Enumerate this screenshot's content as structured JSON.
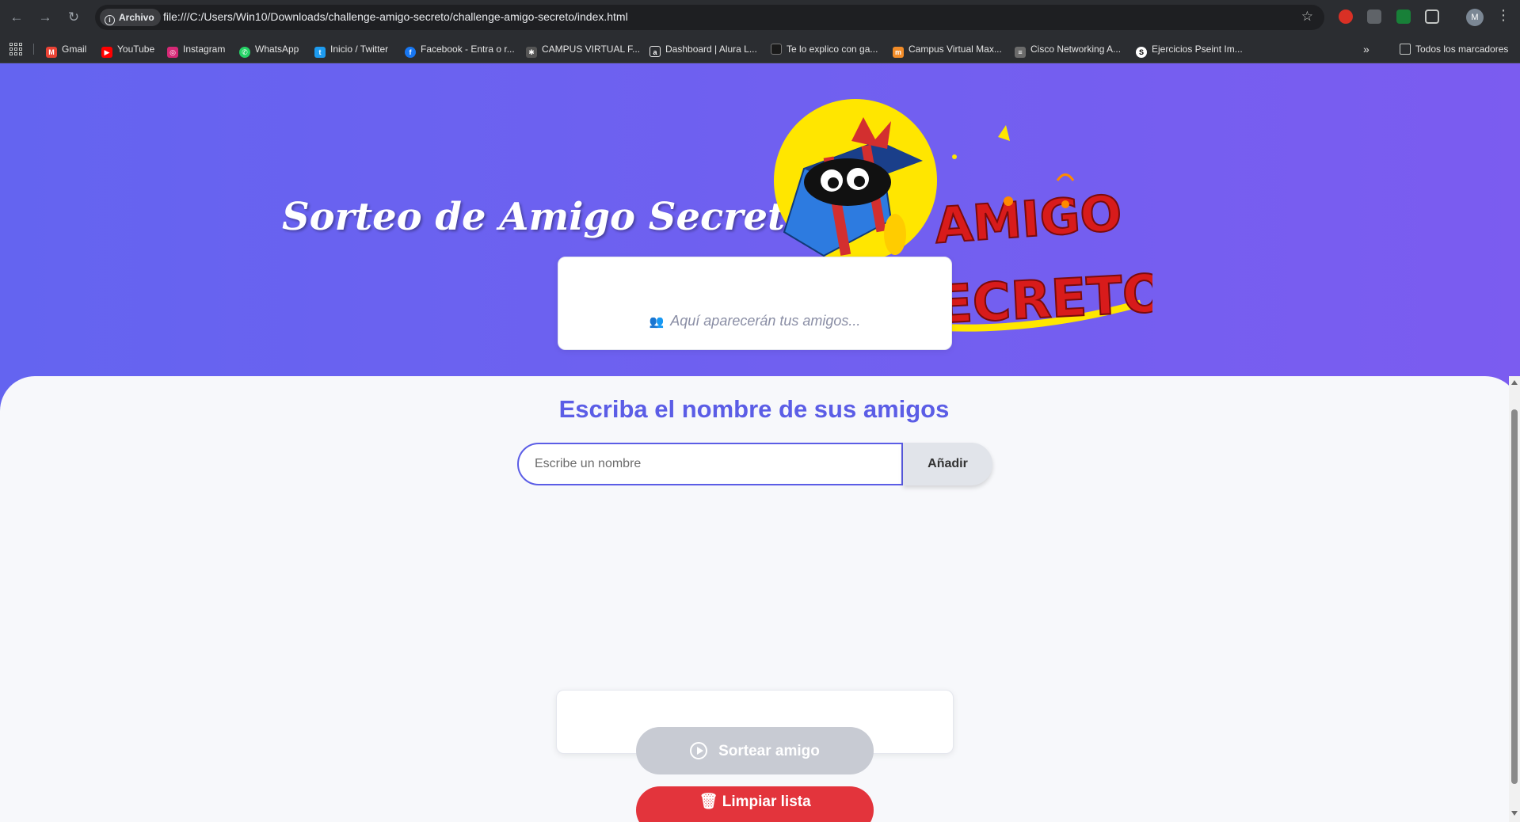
{
  "browser": {
    "security_chip": "Archivo",
    "url": "file:///C:/Users/Win10/Downloads/challenge-amigo-secreto/challenge-amigo-secreto/index.html",
    "profile_initial": "M",
    "all_bookmarks": "Todos los marcadores"
  },
  "bookmarks": [
    {
      "label": "Gmail",
      "icon": "gmail-icon",
      "color": "#ea4335"
    },
    {
      "label": "YouTube",
      "icon": "youtube-icon",
      "color": "#ff0000"
    },
    {
      "label": "Instagram",
      "icon": "instagram-icon",
      "color": "#d62976"
    },
    {
      "label": "WhatsApp",
      "icon": "whatsapp-icon",
      "color": "#25d366"
    },
    {
      "label": "Inicio / Twitter",
      "icon": "twitter-icon",
      "color": "#1d9bf0"
    },
    {
      "label": "Facebook - Entra o r...",
      "icon": "facebook-icon",
      "color": "#1877f2"
    },
    {
      "label": "CAMPUS VIRTUAL F...",
      "icon": "campus-icon",
      "color": "#555555"
    },
    {
      "label": "Dashboard | Alura L...",
      "icon": "alura-icon",
      "color": "#2b2d31"
    },
    {
      "label": "Te lo explico con ga...",
      "icon": "folder-icon",
      "color": "#1a1a1a"
    },
    {
      "label": "Campus Virtual Max...",
      "icon": "maxi-icon",
      "color": "#f28c28"
    },
    {
      "label": "Cisco Networking A...",
      "icon": "cisco-icon",
      "color": "#6b6b6b"
    },
    {
      "label": "Ejercicios Pseint Im...",
      "icon": "pseint-icon",
      "color": "#ffffff"
    }
  ],
  "page": {
    "hero_title": "Sorteo de Amigo Secreto",
    "logo_line1": "AMIGO",
    "logo_line2": "SECRETO",
    "section_title": "Escriba el nombre de sus amigos",
    "input_placeholder": "Escribe un nombre",
    "add_button": "Añadir",
    "empty_list_message": "Aquí aparecerán tus amigos...",
    "draw_button": "Sortear amigo",
    "clear_button": "Limpiar lista"
  },
  "colors": {
    "accent": "#5b5de6",
    "hero_gradient_start": "#6464f0",
    "hero_gradient_end": "#7b5cf0",
    "danger": "#e3343c",
    "disabled": "#c8cbd3"
  }
}
